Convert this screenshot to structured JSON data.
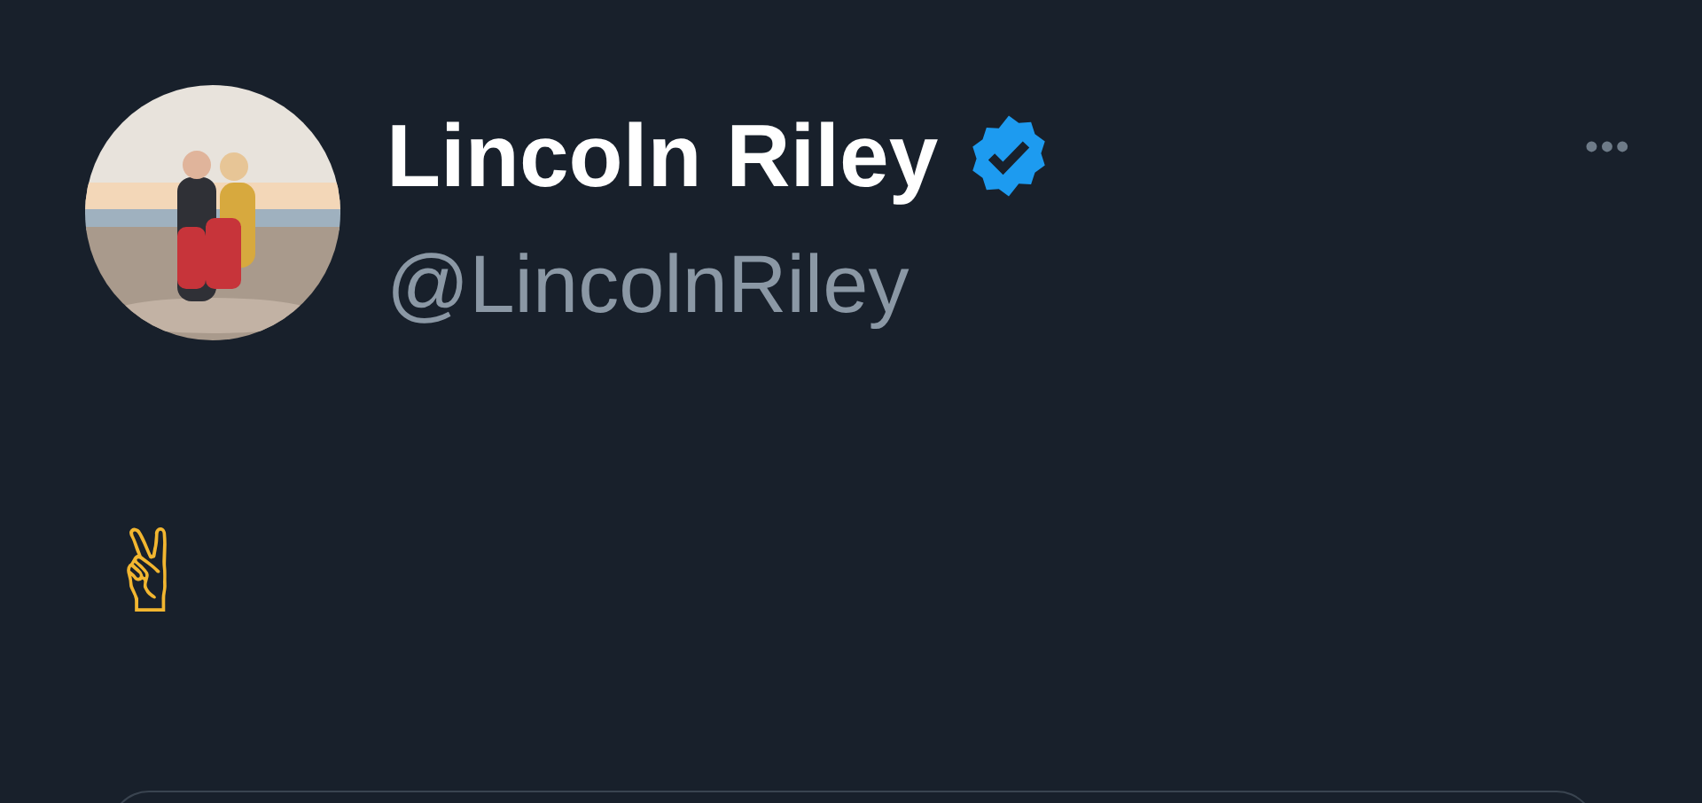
{
  "author": {
    "name": "Lincoln Riley",
    "verified": true,
    "handle": "@LincolnRiley"
  },
  "menu": {
    "label": "•••"
  },
  "tweet": {
    "text": "✌"
  },
  "card": {
    "kind": "card"
  }
}
